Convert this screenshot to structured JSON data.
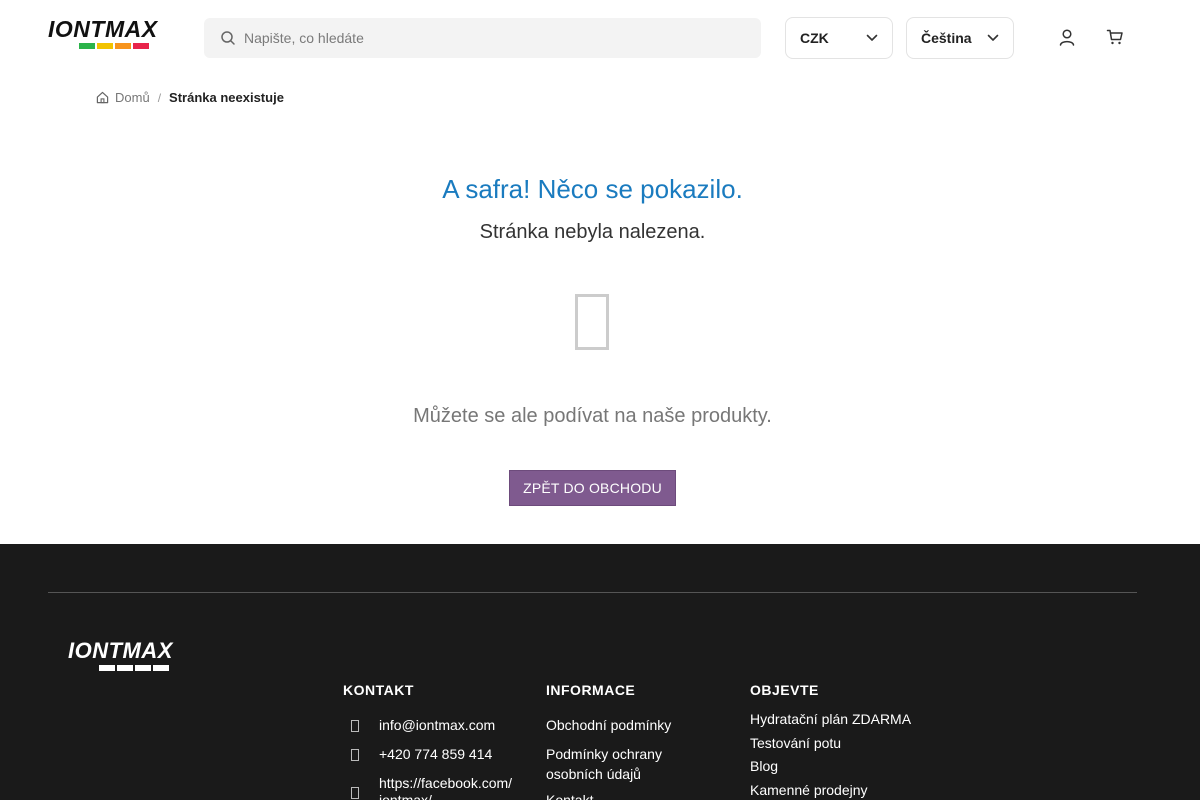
{
  "header": {
    "logo_text": "IONTMAX",
    "logo_bar_colors": [
      "#2bb34a",
      "#f2c300",
      "#f7941d",
      "#e8234a"
    ],
    "search_placeholder": "Napište, co hledáte",
    "currency": "CZK",
    "language": "Čeština"
  },
  "breadcrumb": {
    "home": "Domů",
    "separator": "/",
    "current": "Stránka neexistuje"
  },
  "error": {
    "title": "A safra! Něco se pokazilo.",
    "subtitle": "Stránka nebyla nalezena.",
    "text": "Můžete se ale podívat na naše produkty.",
    "button": "ZPĚT DO OBCHODU",
    "title_color": "#1a7bbf",
    "button_color": "#7f5a8f"
  },
  "footer": {
    "logo_text": "IONTMAX",
    "kontakt": {
      "heading": "KONTAKT",
      "email": "info@iontmax.com",
      "phone": "+420 774 859 414",
      "facebook_line1": "https://facebook.com/",
      "facebook_line2": "iontmax/"
    },
    "informace": {
      "heading": "INFORMACE",
      "link1": "Obchodní podmínky",
      "link2_line1": "Podmínky ochrany",
      "link2_line2": "osobních údajů",
      "link3": "Kontakt"
    },
    "objevte": {
      "heading": "OBJEVTE",
      "links": [
        "Hydratační plán ZDARMA",
        "Testování potu",
        "Blog",
        "Kamenné prodejny"
      ]
    }
  }
}
